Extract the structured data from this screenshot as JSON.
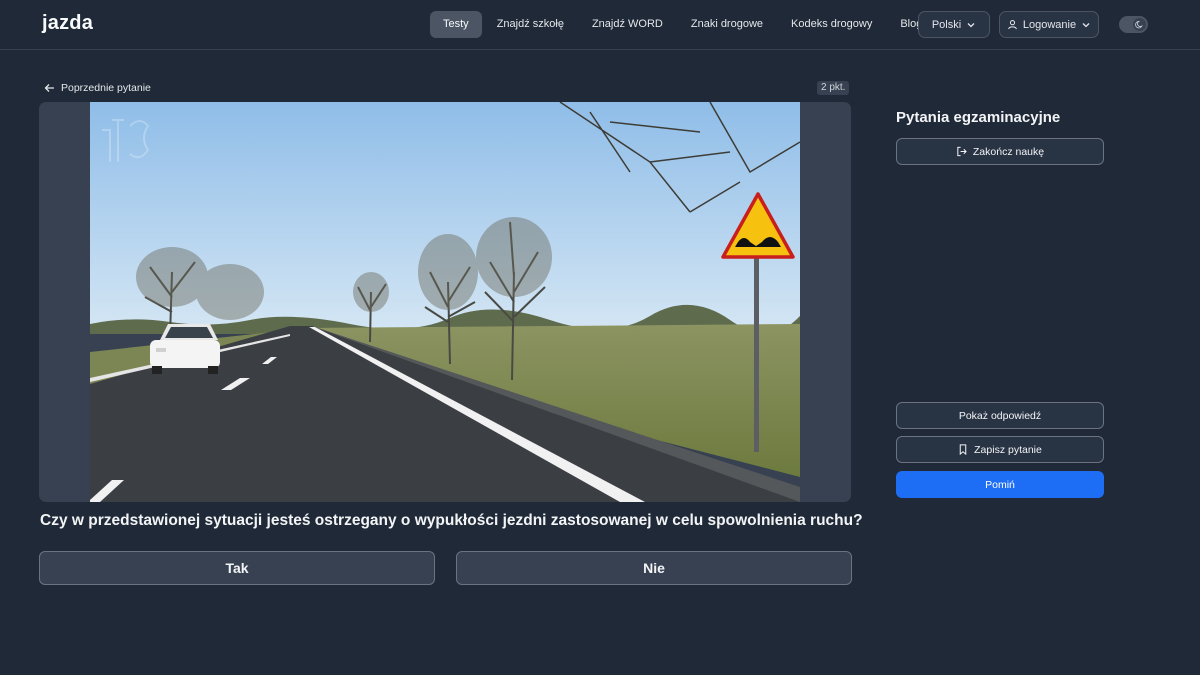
{
  "header": {
    "logo": "jazda",
    "nav": [
      {
        "label": "Testy",
        "active": true
      },
      {
        "label": "Znajdź szkołę",
        "active": false
      },
      {
        "label": "Znajdź WORD",
        "active": false
      },
      {
        "label": "Znaki drogowe",
        "active": false
      },
      {
        "label": "Kodeks drogowy",
        "active": false
      },
      {
        "label": "Blog",
        "active": false
      }
    ],
    "language_label": "Polski",
    "login_label": "Logowanie",
    "theme_icon": "moon-icon"
  },
  "main": {
    "back_label": "Poprzednie pytanie",
    "points_label": "2 pkt.",
    "question": "Czy w przedstawionej sytuacji jesteś ostrzegany o wypukłości jezdni zastosowanej w celu spowolnienia ruchu?",
    "answers": [
      "Tak",
      "Nie"
    ]
  },
  "sidebar": {
    "title": "Pytania egzaminacyjne",
    "finish_label": "Zakończ naukę",
    "show_answer_label": "Pokaż odpowiedź",
    "save_question_label": "Zapisz pytanie",
    "skip_label": "Pomiń"
  },
  "colors": {
    "background": "#1f2937",
    "accent": "#1e6ef5",
    "logo_mark": "#60a5fa"
  }
}
